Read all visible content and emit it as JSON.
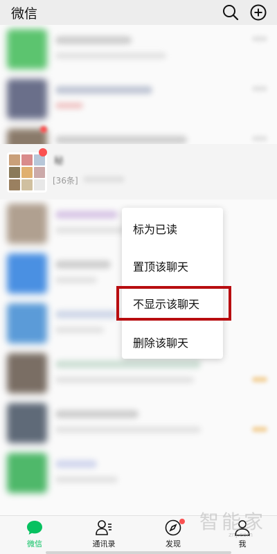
{
  "header": {
    "title": "微信",
    "search_icon": "search-icon",
    "add_icon": "plus-circle-icon"
  },
  "group_chat": {
    "name_fragment": "秘",
    "preview_count": "[36条]"
  },
  "context_menu": {
    "items": [
      {
        "label": "标为已读"
      },
      {
        "label": "置顶该聊天"
      },
      {
        "label": "不显示该聊天"
      },
      {
        "label": "删除该聊天"
      }
    ],
    "highlight_color": "#b80d10"
  },
  "tabbar": {
    "tabs": [
      {
        "label": "微信",
        "icon": "chat-bubble-icon",
        "active": true
      },
      {
        "label": "通讯录",
        "icon": "contacts-icon",
        "active": false
      },
      {
        "label": "发现",
        "icon": "compass-icon",
        "active": false
      },
      {
        "label": "我",
        "icon": "person-icon",
        "active": false
      }
    ],
    "accent_color": "#07c160"
  },
  "watermark": {
    "text": "智能家",
    "sub": "znj.com"
  }
}
